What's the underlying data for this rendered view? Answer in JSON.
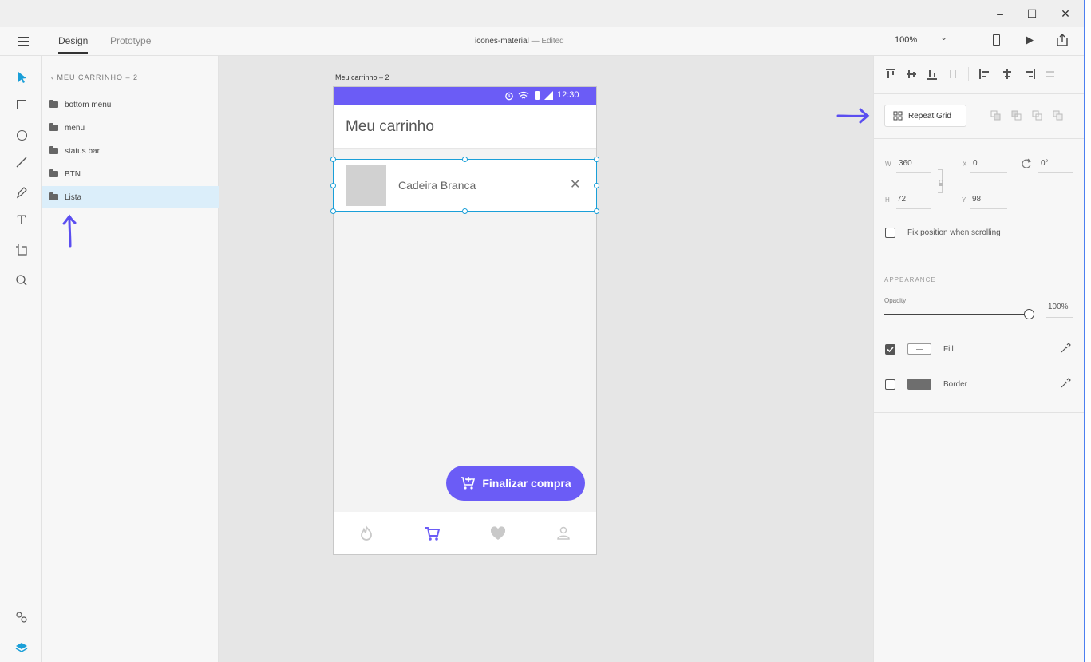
{
  "window": {
    "minimize": "–",
    "maximize": "☐",
    "close": "✕"
  },
  "header": {
    "menu_icon": "hamburger-icon",
    "tabs": [
      {
        "label": "Design"
      },
      {
        "label": "Prototype"
      }
    ],
    "doc_title": "icones-material",
    "doc_status": "— Edited",
    "zoom": "100%",
    "zoom_chevron": "⌄"
  },
  "tools": [
    "select-icon",
    "rectangle-icon",
    "ellipse-icon",
    "line-icon",
    "pen-icon",
    "text-icon",
    "artboard-icon",
    "zoom-icon",
    "plugins-icon",
    "layers-icon"
  ],
  "layers": {
    "breadcrumb": "MEU CARRINHO – 2",
    "items": [
      {
        "label": "bottom menu"
      },
      {
        "label": "menu"
      },
      {
        "label": "status bar"
      },
      {
        "label": "BTN"
      },
      {
        "label": "Lista"
      }
    ]
  },
  "artboard": {
    "label": "Meu carrinho – 2",
    "status_time": "12:30",
    "app_title": "Meu carrinho",
    "list_item": {
      "name": "Cadeira Branca",
      "remove": "✕"
    },
    "fab_label": "Finalizar compra",
    "nav": [
      "flame-icon",
      "cart-icon",
      "heart-icon",
      "profile-icon"
    ]
  },
  "properties": {
    "repeat_grid": "Repeat Grid",
    "w_label": "W",
    "w_value": "360",
    "h_label": "H",
    "h_value": "72",
    "x_label": "X",
    "x_value": "0",
    "y_label": "Y",
    "y_value": "98",
    "rotation": "0°",
    "fix_position": "Fix position when scrolling",
    "appearance": "APPEARANCE",
    "opacity_label": "Opacity",
    "opacity_value": "100%",
    "fill_label": "Fill",
    "border_label": "Border"
  },
  "colors": {
    "accent": "#6b5cf6",
    "selection": "#1a9fd8",
    "annotation": "#5b4ef0"
  }
}
